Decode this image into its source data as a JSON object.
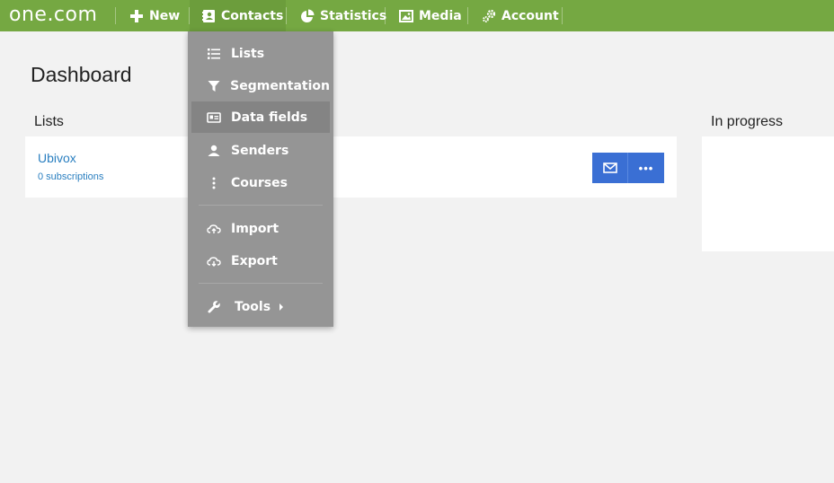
{
  "nav": {
    "logo": "one.com",
    "items": [
      {
        "label": "New",
        "icon": "plus-icon"
      },
      {
        "label": "Contacts",
        "icon": "address-book-icon"
      },
      {
        "label": "Statistics",
        "icon": "pie-chart-icon"
      },
      {
        "label": "Media",
        "icon": "image-icon"
      },
      {
        "label": "Account",
        "icon": "gears-icon"
      }
    ]
  },
  "main": {
    "title": "Dashboard",
    "lists_label": "Lists",
    "in_progress_label": "In progress",
    "list": {
      "name": "Ubivox",
      "subscriptions": "0 subscriptions",
      "more_label": "•••"
    }
  },
  "dropdown": {
    "items": [
      {
        "label": "Lists",
        "icon": "list-icon"
      },
      {
        "label": "Segmentation",
        "icon": "filter-icon"
      },
      {
        "label": "Data fields",
        "icon": "id-card-icon",
        "active": true
      },
      {
        "label": "Senders",
        "icon": "user-icon"
      },
      {
        "label": "Courses",
        "icon": "vertical-dots-icon"
      },
      {
        "label": "Import",
        "icon": "cloud-upload-icon"
      },
      {
        "label": "Export",
        "icon": "cloud-download-icon"
      },
      {
        "label": "Tools",
        "icon": "wrench-icon"
      }
    ]
  },
  "colors": {
    "topbar": "#75a842",
    "accent_button": "#3a6fd4",
    "link": "#2a7fc0",
    "dropdown_bg": "#959595"
  }
}
